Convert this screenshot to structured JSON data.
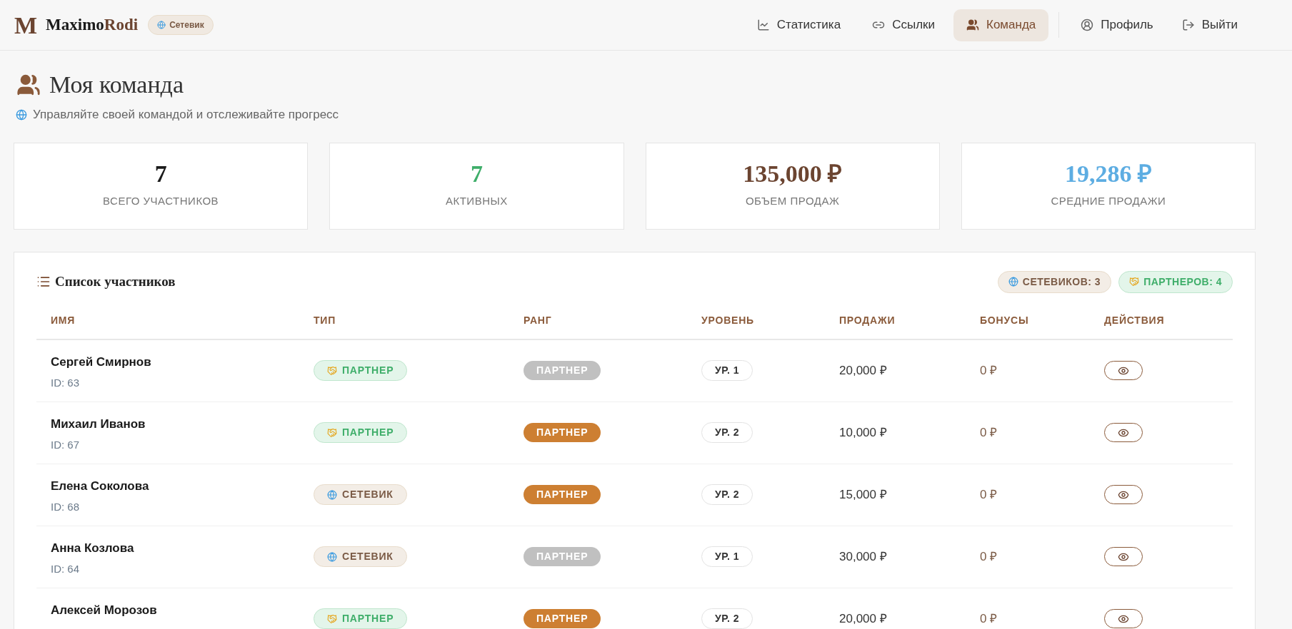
{
  "brand": {
    "mark": "M",
    "name_first": "Maximo",
    "name_second": "Rodi",
    "role_badge": "Сетевик"
  },
  "nav": [
    {
      "label": "Статистика",
      "kind": "chart",
      "selected": false
    },
    {
      "label": "Ссылки",
      "kind": "link",
      "selected": false
    },
    {
      "label": "Команда",
      "kind": "team",
      "selected": true
    }
  ],
  "account": [
    {
      "label": "Профиль",
      "kind": "profile"
    },
    {
      "label": "Выйти",
      "kind": "logout"
    }
  ],
  "page": {
    "title": "Моя команда",
    "subtitle": "Управляйте своей командой и отслеживайте прогресс"
  },
  "stats": [
    {
      "value": "7",
      "label": "ВСЕГО УЧАСТНИКОВ",
      "color": "#1a1a1a"
    },
    {
      "value": "7",
      "label": "АКТИВНЫХ",
      "color": "#3fae6a"
    },
    {
      "value": "135,000 ₽",
      "label": "ОБЪЕМ ПРОДАЖ",
      "color": "#6b4430"
    },
    {
      "value": "19,286 ₽",
      "label": "СРЕДНИЕ ПРОДАЖИ",
      "color": "#5dade2"
    }
  ],
  "members": {
    "title": "Список участников",
    "counters": [
      {
        "label": "СЕТЕВИКОВ: 3",
        "kind": "networker"
      },
      {
        "label": "ПАРТНЕРОВ: 4",
        "kind": "partner"
      }
    ],
    "columns": [
      "ИМЯ",
      "ТИП",
      "РАНГ",
      "УРОВЕНЬ",
      "ПРОДАЖИ",
      "БОНУСЫ",
      "ДЕЙСТВИЯ"
    ],
    "rows": [
      {
        "name": "Сергей Смирнов",
        "id": "ID: 63",
        "type": {
          "label": "ПАРТНЕР",
          "kind": "partner"
        },
        "rank": {
          "label": "ПАРТНЕР",
          "color": "#c0c0c0"
        },
        "level": "УР. 1",
        "sales": "20,000 ₽",
        "bonus": "0 ₽"
      },
      {
        "name": "Михаил Иванов",
        "id": "ID: 67",
        "type": {
          "label": "ПАРТНЕР",
          "kind": "partner"
        },
        "rank": {
          "label": "ПАРТНЕР",
          "color": "#cd7f32"
        },
        "level": "УР. 2",
        "sales": "10,000 ₽",
        "bonus": "0 ₽"
      },
      {
        "name": "Елена Соколова",
        "id": "ID: 68",
        "type": {
          "label": "СЕТЕВИК",
          "kind": "networker"
        },
        "rank": {
          "label": "ПАРТНЕР",
          "color": "#cd7f32"
        },
        "level": "УР. 2",
        "sales": "15,000 ₽",
        "bonus": "0 ₽"
      },
      {
        "name": "Анна Козлова",
        "id": "ID: 64",
        "type": {
          "label": "СЕТЕВИК",
          "kind": "networker"
        },
        "rank": {
          "label": "ПАРТНЕР",
          "color": "#c0c0c0"
        },
        "level": "УР. 1",
        "sales": "30,000 ₽",
        "bonus": "0 ₽"
      },
      {
        "name": "Алексей Морозов",
        "type": {
          "label": "ПАРТНЕР",
          "kind": "partner"
        },
        "rank": {
          "label": "ПАРТНЕР",
          "color": "#cd7f32"
        },
        "level": "УР. 2",
        "sales": "20,000 ₽",
        "bonus": "0 ₽"
      }
    ]
  }
}
